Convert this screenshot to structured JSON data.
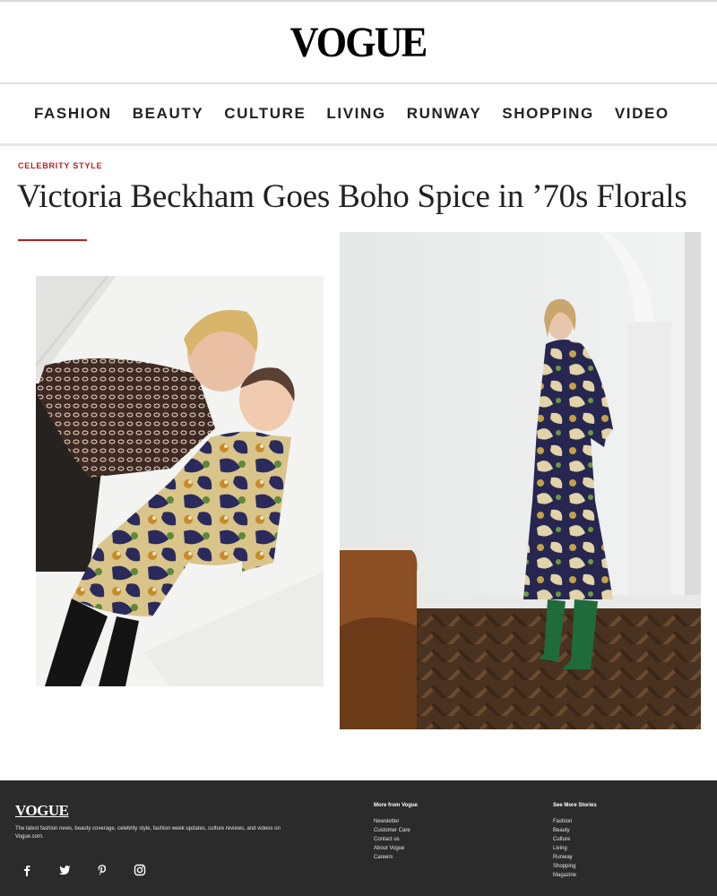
{
  "brand": {
    "logo": "VOGUE"
  },
  "nav": {
    "items": [
      {
        "label": "FASHION"
      },
      {
        "label": "BEAUTY"
      },
      {
        "label": "CULTURE"
      },
      {
        "label": "LIVING"
      },
      {
        "label": "RUNWAY"
      },
      {
        "label": "SHOPPING"
      },
      {
        "label": "VIDEO"
      }
    ]
  },
  "article": {
    "kicker": "CELEBRITY STYLE",
    "headline": "Victoria Beckham Goes Boho Spice in ’70s Florals"
  },
  "colors": {
    "accent": "#b3201f",
    "footer_bg": "#2b2b2b"
  },
  "footer": {
    "logo": "VOGUE",
    "description": "The latest fashion news, beauty coverage, celebrity style, fashion week updates, culture reviews, and videos on Vogue.com.",
    "social": [
      {
        "icon": "facebook-icon"
      },
      {
        "icon": "twitter-icon"
      },
      {
        "icon": "pinterest-icon"
      },
      {
        "icon": "instagram-icon"
      }
    ],
    "more_from_vogue": {
      "heading": "More from Vogue",
      "links": [
        "Newsletter",
        "Customer Care",
        "Contact us",
        "About Vogue",
        "Careers"
      ]
    },
    "see_more_stories": {
      "heading": "See More Stories",
      "links": [
        "Fashion",
        "Beauty",
        "Culture",
        "Living",
        "Runway",
        "Shopping",
        "Magazine"
      ]
    }
  }
}
